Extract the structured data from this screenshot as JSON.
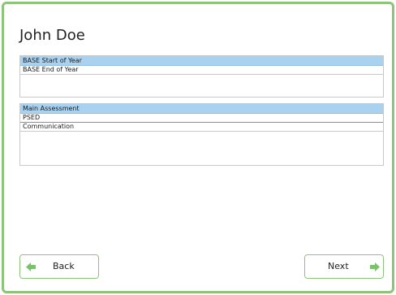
{
  "student": {
    "name": "John Doe"
  },
  "base_panel": {
    "header": "BASE Start of Year",
    "items": [
      {
        "label": "BASE End of Year"
      }
    ]
  },
  "main_panel": {
    "header": "Main Assessment",
    "items": [
      {
        "label": "PSED"
      },
      {
        "label": "Communication"
      }
    ]
  },
  "nav": {
    "back_label": "Back",
    "next_label": "Next"
  },
  "colors": {
    "frame_border": "#8cc47a",
    "header_bg": "#a9d2f0",
    "arrow": "#7ac26a"
  }
}
